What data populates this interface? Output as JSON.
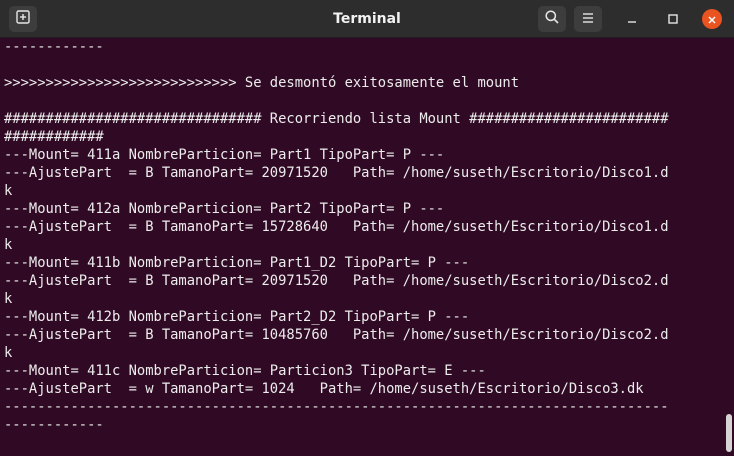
{
  "window": {
    "title": "Terminal"
  },
  "terminal": {
    "lines": [
      "------------",
      "",
      ">>>>>>>>>>>>>>>>>>>>>>>>>>>> Se desmontó exitosamente el mount",
      "",
      "############################### Recorriendo lista Mount ########################",
      "############",
      "---Mount= 411a NombreParticion= Part1 TipoPart= P ---",
      "---AjustePart  = B TamanoPart= 20971520   Path= /home/suseth/Escritorio/Disco1.d",
      "k",
      "---Mount= 412a NombreParticion= Part2 TipoPart= P ---",
      "---AjustePart  = B TamanoPart= 15728640   Path= /home/suseth/Escritorio/Disco1.d",
      "k",
      "---Mount= 411b NombreParticion= Part1_D2 TipoPart= P ---",
      "---AjustePart  = B TamanoPart= 20971520   Path= /home/suseth/Escritorio/Disco2.d",
      "k",
      "---Mount= 412b NombreParticion= Part2_D2 TipoPart= P ---",
      "---AjustePart  = B TamanoPart= 10485760   Path= /home/suseth/Escritorio/Disco2.d",
      "k",
      "---Mount= 411c NombreParticion= Particion3 TipoPart= E ---",
      "---AjustePart  = w TamanoPart= 1024   Path= /home/suseth/Escritorio/Disco3.dk",
      "--------------------------------------------------------------------------------",
      "------------"
    ]
  },
  "icons": {
    "new_tab": "new-tab-icon",
    "search": "search-icon",
    "menu": "hamburger-menu-icon",
    "minimize": "minimize-icon",
    "maximize": "maximize-icon",
    "close": "close-icon"
  },
  "colors": {
    "terminal_bg": "#300a24",
    "terminal_fg": "#ececec",
    "titlebar_bg": "#2d2d2d",
    "close_button": "#e95420"
  }
}
